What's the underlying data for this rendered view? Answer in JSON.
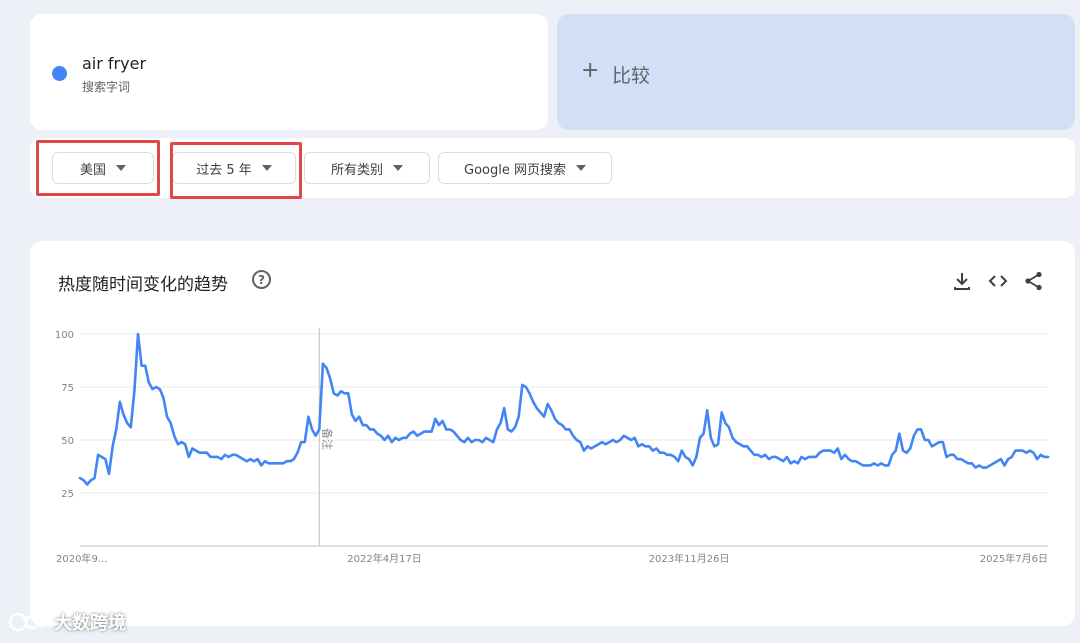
{
  "search_term": {
    "name": "air fryer",
    "sublabel": "搜索字词",
    "color": "#4285f4"
  },
  "compare": {
    "plus": "+",
    "label": "比较"
  },
  "filters": [
    {
      "label": "美国",
      "highlighted": true
    },
    {
      "label": "过去 5 年",
      "highlighted": true
    },
    {
      "label": "所有类别",
      "highlighted": false
    },
    {
      "label": "Google 网页搜索",
      "highlighted": false
    }
  ],
  "chart_card": {
    "title": "热度随时间变化的趋势",
    "help": "?",
    "tools": [
      "download-icon",
      "embed-code-icon",
      "share-icon"
    ]
  },
  "chart_data": {
    "type": "line",
    "title": "热度随时间变化的趋势",
    "ylim": [
      0,
      100
    ],
    "y_ticks": [
      25,
      50,
      75,
      100
    ],
    "x_tick_labels": [
      "2020年9...",
      "2022年4月17日",
      "2023年11月26日",
      "2025年7月6日"
    ],
    "x_tick_weeks": [
      0,
      84,
      168,
      252
    ],
    "grid": true,
    "line_color": "#4285f4",
    "annotation": {
      "label": "备注",
      "week": 66
    },
    "series": [
      {
        "values": [
          32,
          31,
          29,
          31,
          32,
          43,
          42,
          41,
          34,
          47,
          55,
          68,
          62,
          58,
          56,
          73,
          100,
          85,
          85,
          77,
          74,
          75,
          74,
          70,
          61,
          58,
          52,
          48,
          49,
          48,
          42,
          46,
          45,
          44,
          44,
          44,
          42,
          42,
          42,
          41,
          43,
          42,
          43,
          43,
          42,
          41,
          40,
          41,
          40,
          41,
          38,
          40,
          39,
          39,
          39,
          39,
          39,
          40,
          40,
          41,
          44,
          49,
          49,
          61,
          55,
          52,
          55,
          86,
          84,
          79,
          72,
          71,
          73,
          72,
          72,
          62,
          59,
          61,
          57,
          57,
          55,
          55,
          53,
          52,
          50,
          52,
          49,
          51,
          50,
          51,
          51,
          53,
          54,
          52,
          53,
          54,
          54,
          54,
          60,
          57,
          59,
          55,
          55,
          54,
          52,
          50,
          49,
          51,
          49,
          50,
          50,
          49,
          51,
          50,
          49,
          55,
          58,
          65,
          55,
          54,
          56,
          61,
          76,
          75,
          72,
          68,
          65,
          63,
          61,
          67,
          64,
          60,
          58,
          57,
          55,
          55,
          52,
          50,
          49,
          45,
          47,
          46,
          47,
          48,
          49,
          48,
          49,
          50,
          49,
          50,
          52,
          51,
          50,
          51,
          47,
          48,
          47,
          47,
          45,
          46,
          44,
          44,
          43,
          43,
          42,
          40,
          45,
          42,
          41,
          38,
          42,
          51,
          53,
          64,
          51,
          47,
          48,
          63,
          58,
          56,
          51,
          49,
          48,
          47,
          47,
          45,
          43,
          43,
          42,
          43,
          41,
          42,
          42,
          41,
          40,
          42,
          39,
          40,
          39,
          42,
          41,
          42,
          42,
          42,
          44,
          45,
          45,
          45,
          44,
          46,
          41,
          43,
          41,
          40,
          40,
          39,
          38,
          38,
          38,
          39,
          38,
          39,
          38,
          38,
          43,
          45,
          53,
          45,
          44,
          46,
          52,
          55,
          55,
          50,
          50,
          47,
          48,
          49,
          49,
          42,
          43,
          43,
          41,
          41,
          40,
          39,
          39,
          37,
          38,
          37,
          37,
          38,
          39,
          40,
          41,
          38,
          41,
          42,
          45,
          45,
          45,
          44,
          45,
          44,
          41,
          43,
          42,
          42
        ]
      }
    ]
  },
  "watermark": {
    "text": "大数跨境"
  }
}
